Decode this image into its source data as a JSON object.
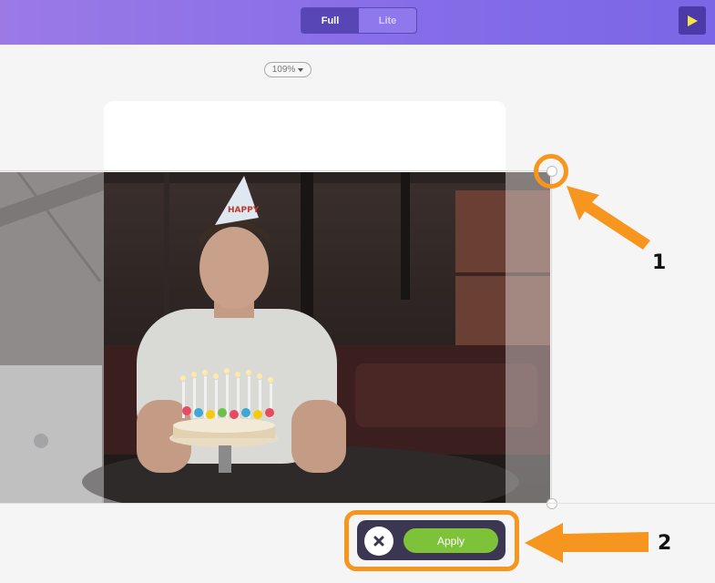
{
  "header": {
    "mode_options": [
      {
        "label": "Full",
        "active": true
      },
      {
        "label": "Lite",
        "active": false
      }
    ],
    "play_icon": "play-icon",
    "accent_color": "#5846b7",
    "play_icon_color": "#f5e44a"
  },
  "canvas": {
    "zoom_label": "109%",
    "image_subject": "man with party hat and birthday cake with candles"
  },
  "crop_actions": {
    "cancel_icon": "close-icon",
    "apply_label": "Apply",
    "apply_color": "#7ec23a"
  },
  "callouts": {
    "first": "1",
    "second": "2",
    "color": "#f7961e"
  }
}
